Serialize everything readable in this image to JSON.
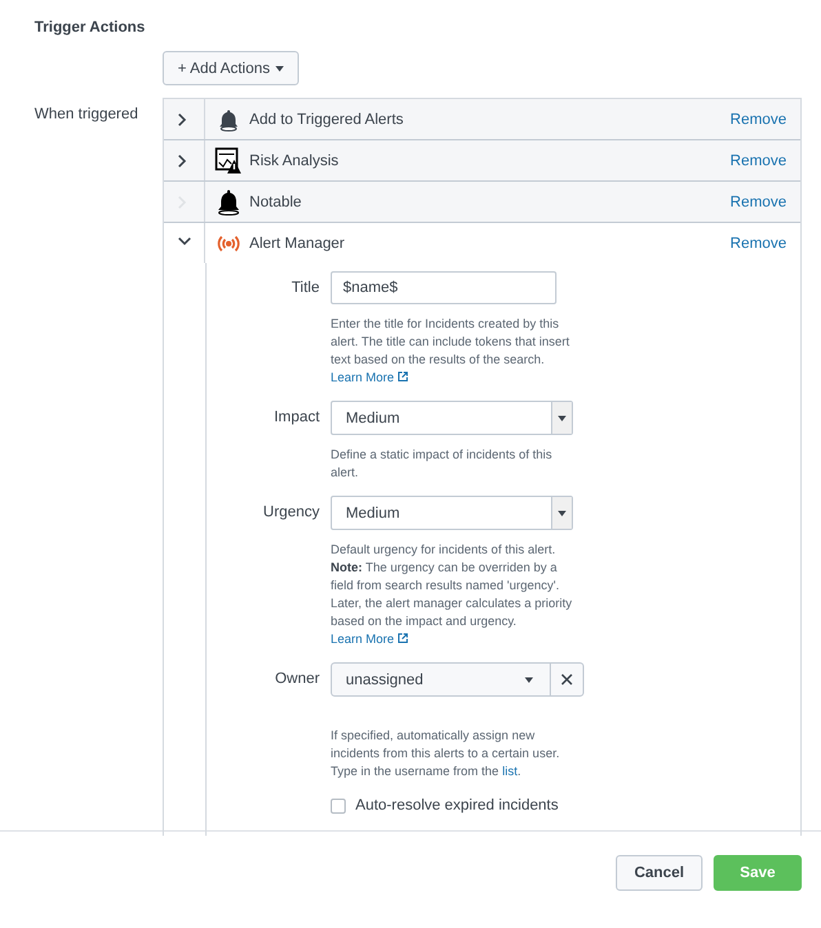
{
  "section_title": "Trigger Actions",
  "add_button": "+ Add Actions",
  "when_label": "When triggered",
  "actions": [
    {
      "name": "Add to Triggered Alerts",
      "expanded": false,
      "disabled": false,
      "remove": "Remove"
    },
    {
      "name": "Risk Analysis",
      "expanded": false,
      "disabled": false,
      "remove": "Remove"
    },
    {
      "name": "Notable",
      "expanded": false,
      "disabled": true,
      "remove": "Remove"
    },
    {
      "name": "Alert Manager",
      "expanded": true,
      "disabled": false,
      "remove": "Remove"
    }
  ],
  "form": [
    {
      "kind": "text",
      "label": "Title",
      "value": "$name$",
      "help": [
        {
          "text": "Enter the title for Incidents created by this alert. The title can include tokens that insert text based on the results of the search."
        },
        {
          "link": "Learn More",
          "external": true
        }
      ]
    },
    {
      "kind": "select",
      "label": "Impact",
      "value": "Medium",
      "help": [
        {
          "text": "Define a static impact of incidents of this alert."
        }
      ]
    },
    {
      "kind": "select",
      "label": "Urgency",
      "value": "Medium",
      "help": [
        {
          "text": "Default urgency for incidents of this alert. **Note:** The urgency can be overriden by a field from search results named 'urgency'. Later, the alert manager calculates a priority based on the impact and urgency."
        },
        {
          "link": "Learn More",
          "external": true
        }
      ]
    },
    {
      "kind": "owner",
      "label": "Owner",
      "value": "unassigned",
      "help": [
        {
          "text": "If specified, automatically assign new incidents from this alerts to a certain user. Type in the username from the"
        },
        {
          "link": "list"
        },
        {
          "text": "."
        }
      ]
    },
    {
      "kind": "checkbox",
      "label": "Auto-resolve expired incidents",
      "checked": false
    }
  ],
  "footer": {
    "cancel": "Cancel",
    "save": "Save"
  }
}
